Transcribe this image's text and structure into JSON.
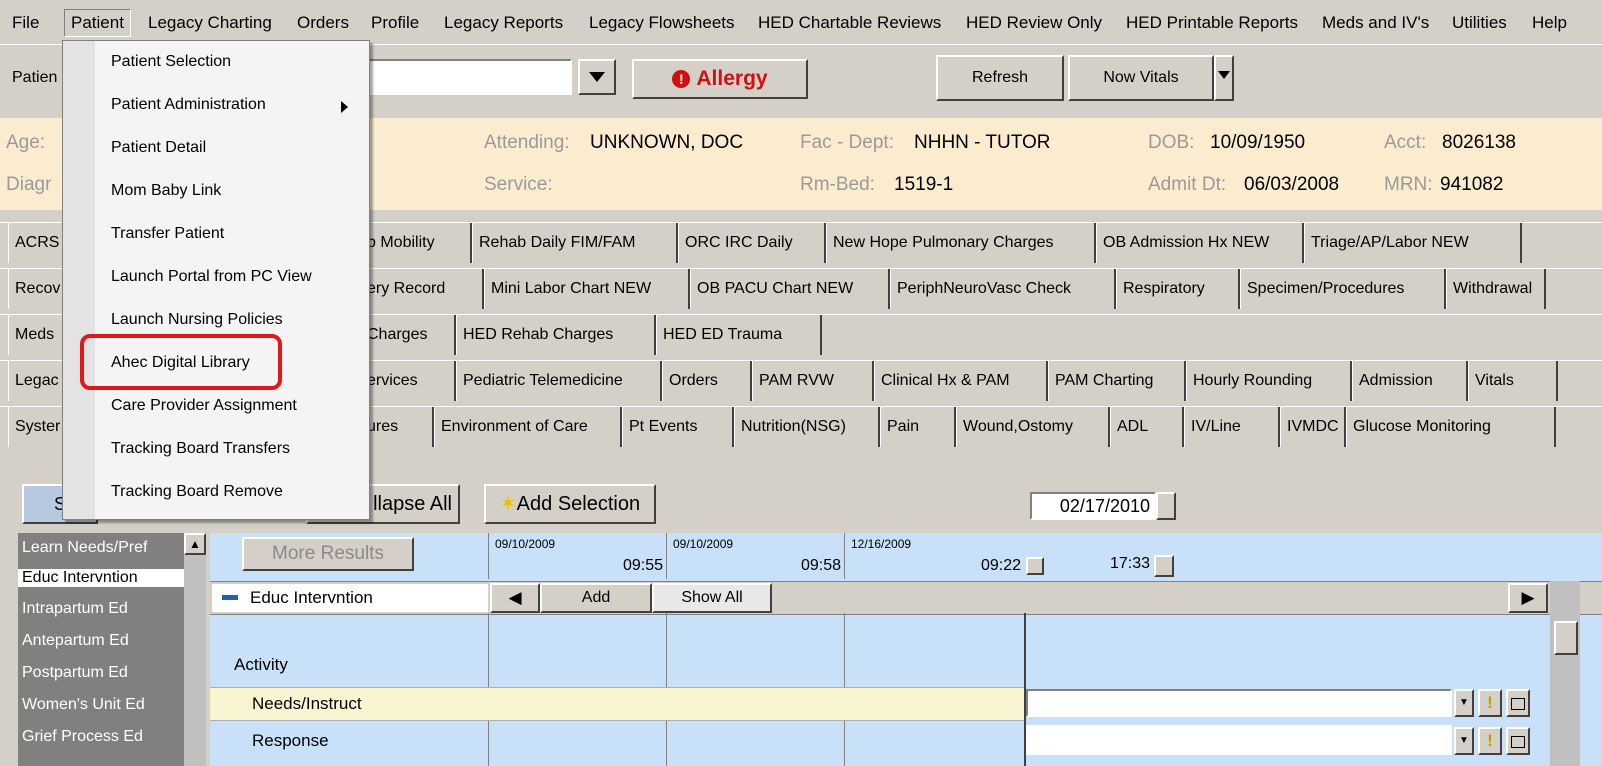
{
  "menubar": [
    "File",
    "Patient",
    "Legacy Charting",
    "Orders",
    "Profile",
    "Legacy Reports",
    "Legacy Flowsheets",
    "HED Chartable Reviews",
    "HED Review Only",
    "HED Printable Reports",
    "Meds and IV's",
    "Utilities",
    "Help"
  ],
  "toolbar": {
    "patient_label": "Patien",
    "allergy_label": "Allergy",
    "refresh_label": "Refresh",
    "now_vitals_label": "Now Vitals"
  },
  "banner": {
    "age_label": "Age:",
    "diag_label": "Diagr",
    "attending_label": "Attending:",
    "attending_value": "UNKNOWN, DOC",
    "service_label": "Service:",
    "facdept_label": "Fac - Dept:",
    "facdept_value": "NHHN - TUTOR",
    "rmbed_label": "Rm-Bed:",
    "rmbed_value": "1519-1",
    "dob_label": "DOB:",
    "dob_value": "10/09/1950",
    "admit_label": "Admit Dt:",
    "admit_value": "06/03/2008",
    "acct_label": "Acct:",
    "acct_value": "8026138",
    "mrn_label": "MRN:",
    "mrn_value": "941082"
  },
  "tabs": {
    "row1": [
      "ACRS",
      "b Mobility",
      "Rehab Daily FIM/FAM",
      "ORC IRC Daily",
      "New Hope Pulmonary Charges",
      "OB Admission Hx NEW",
      "Triage/AP/Labor NEW"
    ],
    "row2": [
      "Recov",
      "ery Record",
      "Mini Labor Chart NEW",
      "OB PACU Chart NEW",
      "PeriphNeuroVasc Check",
      "Respiratory",
      "Specimen/Procedures",
      "Withdrawal"
    ],
    "row3": [
      "Meds",
      "Charges",
      "HED Rehab Charges",
      "HED ED Trauma"
    ],
    "row4": [
      "Legac",
      "ervices",
      "Pediatric Telemedicine",
      "Orders",
      "PAM RVW",
      "Clinical Hx & PAM",
      "PAM Charting",
      "Hourly Rounding",
      "Admission",
      "Vitals"
    ],
    "row5": [
      "Syster",
      "ures",
      "Environment of Care",
      "Pt Events",
      "Nutrition(NSG)",
      "Pain",
      "Wound,Ostomy",
      "ADL",
      "IV/Line",
      "IVMDC",
      "Glucose Monitoring"
    ]
  },
  "lower": {
    "s_button": "S",
    "collapse_all": "llapse All",
    "add_selection": "Add Selection",
    "date": "02/17/2010",
    "time": "17:33",
    "more_results": "More Results",
    "left_list": [
      "Learn Needs/Pref",
      "Educ Intervntion",
      "Intrapartum Ed",
      "Antepartum Ed",
      "Postpartum Ed",
      "Women's Unit Ed",
      "Grief Process Ed"
    ],
    "columns": [
      {
        "date": "09/10/2009",
        "time": "09:55"
      },
      {
        "date": "09/10/2009",
        "time": "09:58"
      },
      {
        "date": "12/16/2009",
        "time": "09:22"
      }
    ],
    "section_title": "Educ Intervntion",
    "add_label": "Add",
    "show_all_label": "Show All",
    "activity": "Activity",
    "needs": "Needs/Instruct",
    "response": "Response"
  },
  "dropdown": {
    "items": [
      "Patient Selection",
      "Patient Administration",
      "Patient Detail",
      "Mom Baby Link",
      "Transfer Patient",
      "Launch Portal from PC View",
      "Launch Nursing Policies",
      "Ahec Digital Library",
      "Care Provider Assignment",
      "Tracking Board Transfers",
      "Tracking Board Remove"
    ]
  },
  "colors": {
    "allergy": "#d01010",
    "highlight": "#e01818",
    "banner": "#fbecd0",
    "grid": "#c8e0f8"
  }
}
